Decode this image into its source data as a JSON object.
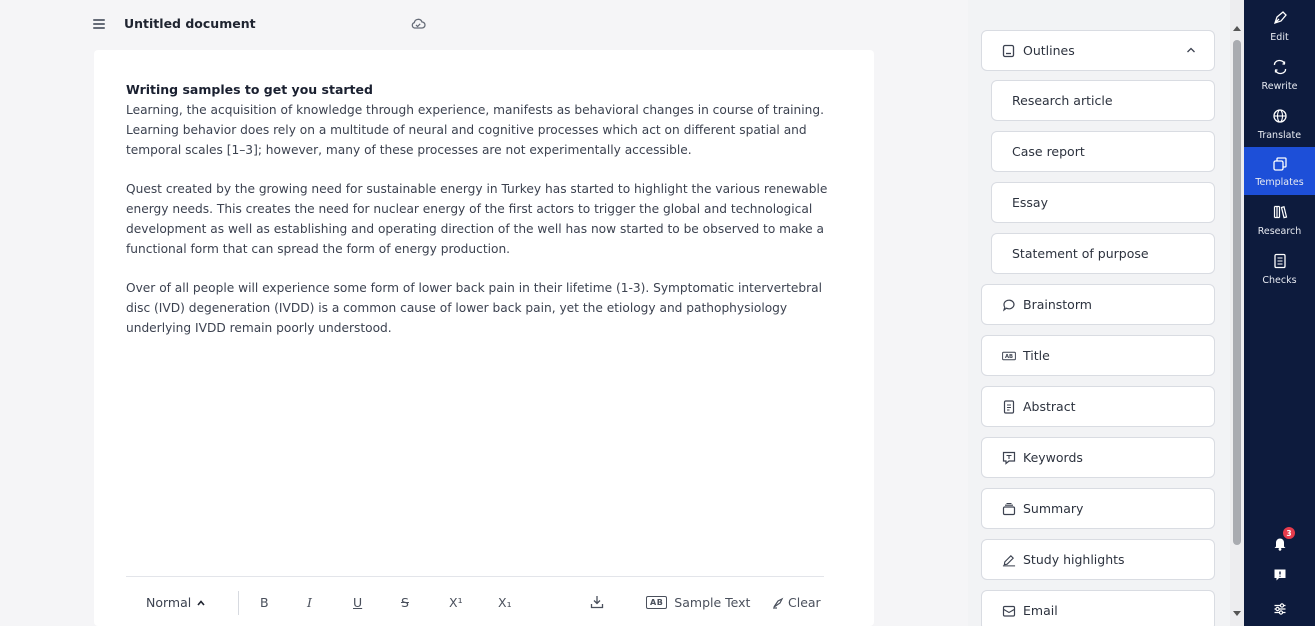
{
  "document": {
    "title": "Untitled document",
    "heading": "Writing samples to get you started",
    "paragraphs": [
      "Learning, the acquisition of knowledge through experience, manifests as behavioral changes in course of training. Learning behavior does rely on a multitude of neural and cognitive processes which act on different spatial and temporal scales [1–3]; however, many of these processes are not experimentally accessible.",
      "Quest created by the growing need for sustainable energy in Turkey has started to highlight the various renewable energy needs. This creates the need for nuclear energy of the first actors to trigger the global and technological development as well as establishing and operating direction of the well has now started to be observed to make a functional form that can spread the form of energy production.",
      "Over of all people will experience some form of lower back pain in their lifetime (1-3). Symptomatic intervertebral disc (IVD) degeneration (IVDD) is a common cause of lower back pain, yet the etiology and pathophysiology underlying IVDD remain poorly understood."
    ]
  },
  "toolbar": {
    "style_label": "Normal",
    "bold": "B",
    "italic": "I",
    "underline": "U",
    "strike": "S",
    "superscript": "X¹",
    "subscript": "X₁",
    "sample_text_badge": "AB",
    "sample_text_label": "Sample Text",
    "clear_label": "Clear"
  },
  "templates": {
    "outlines_label": "Outlines",
    "outline_items": [
      "Research article",
      "Case report",
      "Essay",
      "Statement of purpose"
    ],
    "items": [
      {
        "label": "Brainstorm",
        "icon": "speech-bubble-icon"
      },
      {
        "label": "Title",
        "icon": "ab-badge-icon"
      },
      {
        "label": "Abstract",
        "icon": "document-icon"
      },
      {
        "label": "Keywords",
        "icon": "tag-message-icon"
      },
      {
        "label": "Summary",
        "icon": "stack-icon"
      },
      {
        "label": "Study highlights",
        "icon": "highlighter-icon"
      },
      {
        "label": "Email",
        "icon": "envelope-icon"
      }
    ]
  },
  "rail": {
    "items": [
      {
        "label": "Edit",
        "icon": "pen-nib-icon"
      },
      {
        "label": "Rewrite",
        "icon": "arrows-cycle-icon"
      },
      {
        "label": "Translate",
        "icon": "globe-icon"
      },
      {
        "label": "Templates",
        "icon": "templates-icon"
      },
      {
        "label": "Research",
        "icon": "books-icon"
      },
      {
        "label": "Checks",
        "icon": "checklist-icon"
      }
    ],
    "notification_count": "3"
  },
  "colors": {
    "rail_bg": "#0d1b3d",
    "rail_active": "#1d4fd8",
    "badge": "#e53b4c"
  }
}
